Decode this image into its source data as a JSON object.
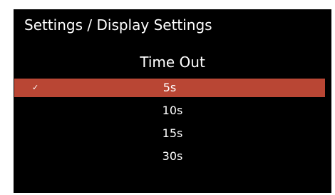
{
  "header": {
    "breadcrumb": "Settings / Display Settings"
  },
  "menu": {
    "title": "Time Out",
    "selected_index": 0,
    "check_glyph": "✓",
    "options": [
      {
        "label": "5s",
        "selected": true
      },
      {
        "label": "10s",
        "selected": false
      },
      {
        "label": "15s",
        "selected": false
      },
      {
        "label": "30s",
        "selected": false
      }
    ]
  },
  "colors": {
    "background": "#000000",
    "highlight": "#b94634",
    "text": "#ffffff"
  }
}
